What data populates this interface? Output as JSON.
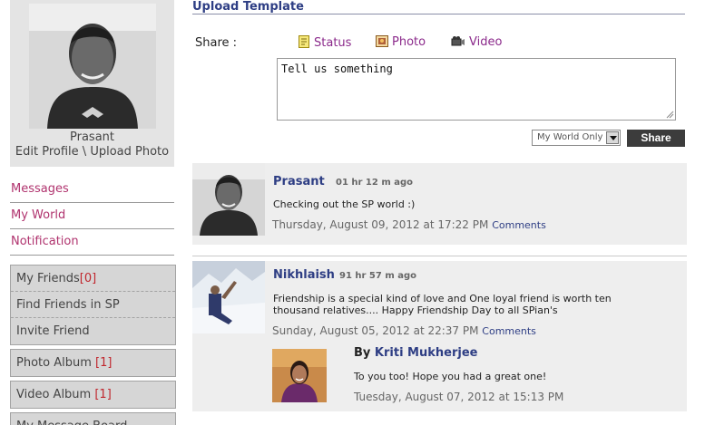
{
  "profile": {
    "name": "Prasant",
    "edit_profile": "Edit Profile",
    "separator": "\\",
    "upload_photo": "Upload Photo"
  },
  "menu": {
    "messages": "Messages",
    "my_world": "My World",
    "notification": "Notification"
  },
  "friends_group": [
    {
      "label": "My Friends",
      "count": "[0]"
    },
    {
      "label": "Find Friends in SP",
      "count": ""
    },
    {
      "label": "Invite Friend",
      "count": ""
    }
  ],
  "photo_album": {
    "label": "Photo Album",
    "count": "[1]"
  },
  "video_album": {
    "label": "Video Album",
    "count": "[1]"
  },
  "message_board": {
    "label": "My Message Board"
  },
  "upload": {
    "title": "Upload Template",
    "share_label": "Share :",
    "options": {
      "status": "Status",
      "photo": "Photo",
      "video": "Video"
    },
    "textarea_value": "Tell us something",
    "privacy_value": "My World Only",
    "share_button": "Share"
  },
  "posts": [
    {
      "author": "Prasant",
      "time": "01 hr  12 m  ago",
      "text": "Checking out the SP world :)",
      "date": "Thursday, August 09, 2012 at 17:22 PM",
      "comments_label": "Comments"
    },
    {
      "author": "Nikhlaish",
      "time": "91 hr  57 m  ago",
      "text": "Friendship is a special kind of love and One loyal friend is worth ten thousand relatives.... Happy Friendship Day to all SPian's",
      "date": "Sunday, August 05, 2012 at 22:37 PM",
      "comments_label": "Comments",
      "reply": {
        "by_label": "By",
        "author": "Kriti Mukherjee",
        "text": "To you too! Hope you had a great one!",
        "date": "Tuesday, August 07, 2012 at 15:13 PM"
      }
    }
  ],
  "colors": {
    "accent_link": "#b0336e",
    "author_blue": "#2e3e84",
    "count_red": "#c0262d",
    "share_option": "#8b2a8b"
  },
  "icons": {
    "status": "note-icon",
    "photo": "picture-icon",
    "video": "video-camera-icon"
  }
}
